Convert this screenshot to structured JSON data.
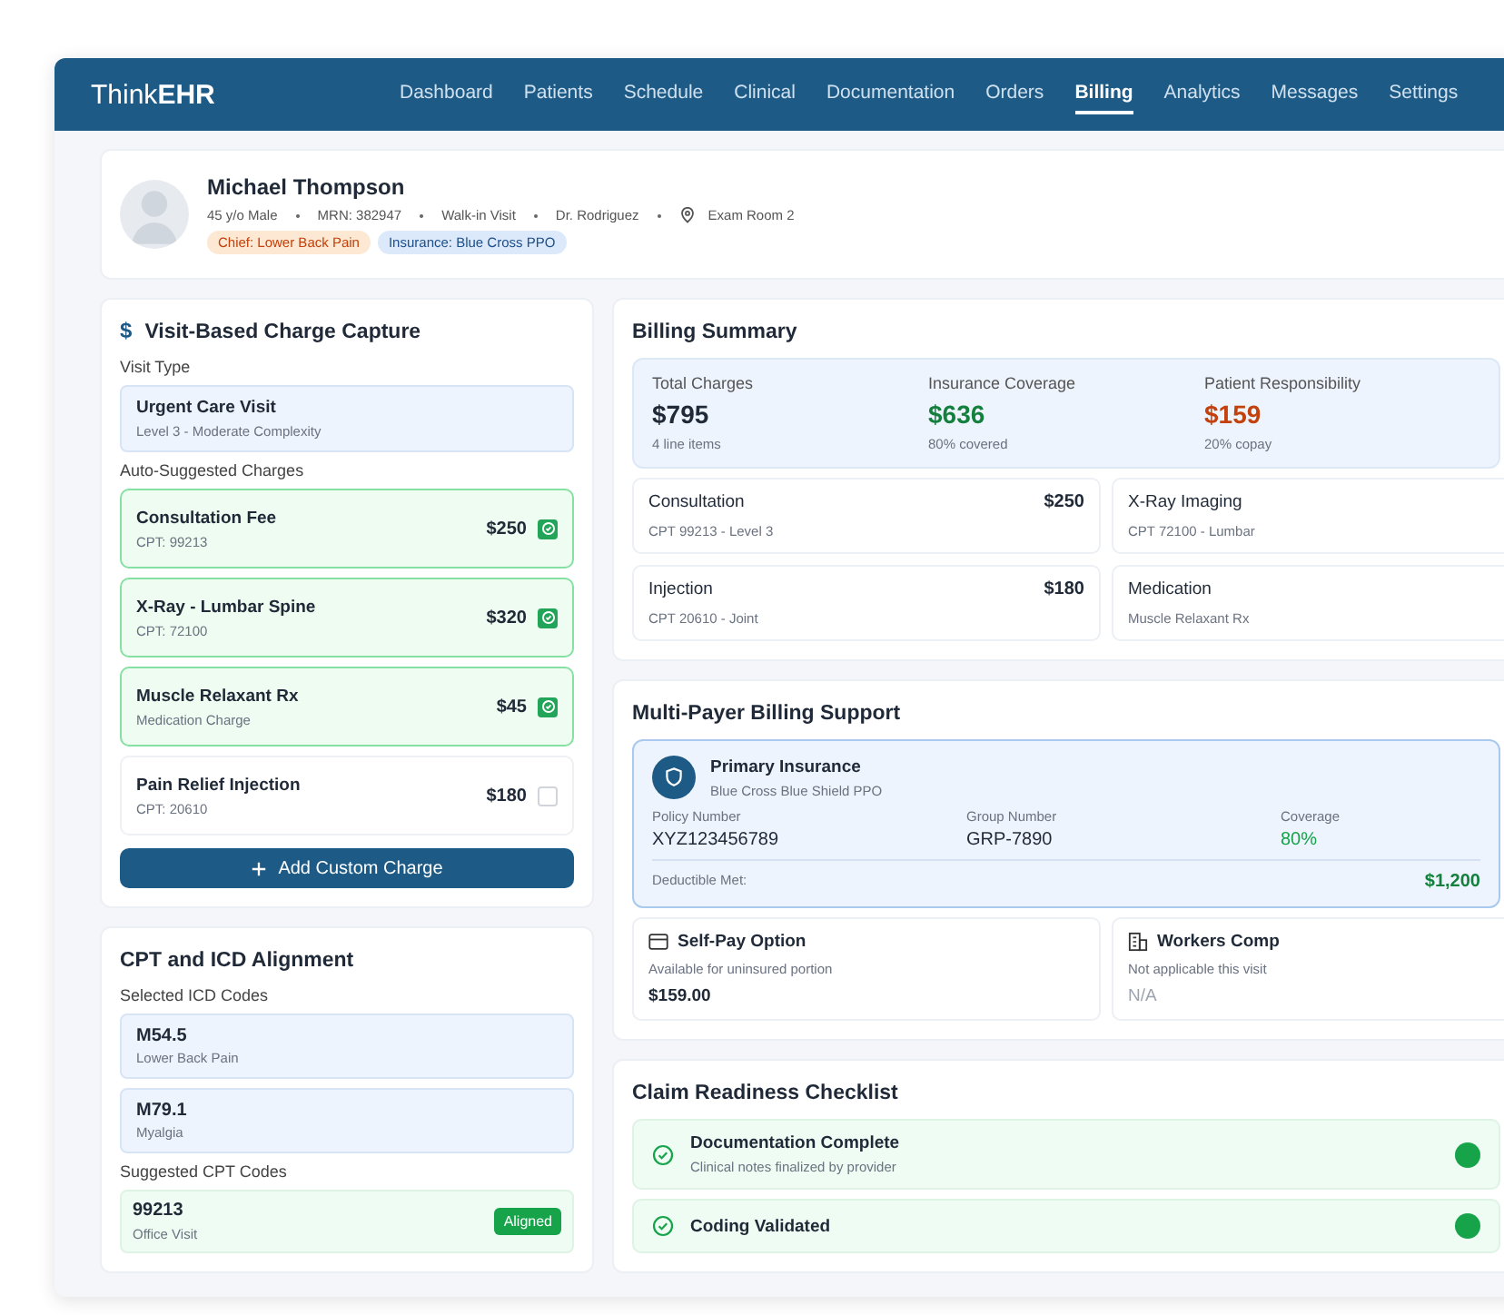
{
  "app": {
    "logo": "Think**EHR**"
  },
  "nav": [
    {
      "label": "Dashboard",
      "selected": false
    },
    {
      "label": "Patients",
      "selected": false
    },
    {
      "label": "Schedule",
      "selected": false
    },
    {
      "label": "Clinical",
      "selected": false
    },
    {
      "label": "Documentation",
      "selected": false
    },
    {
      "label": "Orders",
      "selected": false
    },
    {
      "label": "Billing",
      "selected": true
    },
    {
      "label": "Analytics",
      "selected": false
    },
    {
      "label": "Messages",
      "selected": false
    },
    {
      "label": "Settings",
      "selected": false
    }
  ],
  "patient": {
    "name": "Michael Thompson",
    "details": [
      "45 y/o Male",
      "MRN: 382947",
      "Walk-in Visit",
      "Dr. Rodriguez"
    ],
    "room": "Exam Room 2",
    "tags": [
      {
        "label": "Chief: Lower Back Pain",
        "color": "#fde8d4"
      },
      {
        "label": "Insurance: Blue Cross PPO",
        "color": "#dbe9fb"
      }
    ]
  },
  "charge_capture": {
    "icon": "$",
    "title": "Visit-Based Charge Capture",
    "visit_type_label": "Visit Type",
    "visit_type": {
      "name": "Urgent Care Visit",
      "level": "Level 3 - Moderate Complexity"
    },
    "suggested_label": "Auto-Suggested Charges",
    "charges": [
      {
        "name": "Consultation Fee",
        "code": "CPT: 99213",
        "amount": "$250",
        "checked": true
      },
      {
        "name": "X-Ray - Lumbar Spine",
        "code": "CPT: 72100",
        "amount": "$320",
        "checked": true
      },
      {
        "name": "Muscle Relaxant Rx",
        "code": "Medication Charge",
        "amount": "$45",
        "checked": true
      },
      {
        "name": "Pain Relief Injection",
        "code": "CPT: 20610",
        "amount": "$180",
        "checked": false
      }
    ],
    "add_button": "Add Custom Charge"
  },
  "alignment": {
    "title": "CPT and ICD Alignment",
    "icd_label": "Selected ICD Codes",
    "icd_codes": [
      {
        "code": "M54.5",
        "description": "Lower Back Pain"
      },
      {
        "code": "M79.1",
        "description": "Myalgia"
      }
    ],
    "cpt_label": "Suggested CPT Codes",
    "cpt_codes": [
      {
        "code": "99213",
        "description": "Office Visit",
        "status": "Aligned"
      }
    ]
  },
  "billing_summary": {
    "title": "Billing Summary",
    "stats": [
      {
        "label": "Total Charges",
        "value": "$795",
        "note": "4 line items",
        "color": "#1f2937"
      },
      {
        "label": "Insurance Coverage",
        "value": "$636",
        "note": "80% covered",
        "color": "#15803d"
      },
      {
        "label": "Patient Responsibility",
        "value": "$159",
        "note": "20% copay",
        "color": "#c2410c"
      }
    ],
    "items": [
      {
        "name": "Consultation",
        "code": "CPT 99213 - Level 3",
        "amount": "$250"
      },
      {
        "name": "X-Ray Imaging",
        "code": "CPT 72100 - Lumbar"
      },
      {
        "name": "Injection",
        "code": "CPT 20610 - Joint",
        "amount": "$180"
      },
      {
        "name": "Medication",
        "code": "Muscle Relaxant Rx"
      }
    ]
  },
  "multi_payer": {
    "title": "Multi-Payer Billing Support",
    "primary": {
      "title": "Primary Insurance",
      "plan": "Blue Cross Blue Shield PPO",
      "fields": [
        {
          "label": "Policy Number",
          "value": "XYZ123456789"
        },
        {
          "label": "Group Number",
          "value": "GRP-7890"
        },
        {
          "label": "Coverage",
          "value": "80%"
        }
      ],
      "deductible_label": "Deductible Met:",
      "deductible": "$1,200"
    },
    "options": [
      {
        "kind": "card",
        "title": "Self-Pay Option",
        "note": "Available for uninsured portion",
        "value": "$159.00",
        "disabled": false
      },
      {
        "kind": "building",
        "title": "Workers Comp",
        "note": "Not applicable this visit",
        "value": "N/A",
        "disabled": true
      }
    ]
  },
  "checklist": {
    "title": "Claim Readiness Checklist",
    "items": [
      {
        "title": "Documentation Complete",
        "note": "Clinical notes finalized by provider",
        "checked": true
      },
      {
        "title": "Coding Validated",
        "checked": true
      }
    ]
  }
}
